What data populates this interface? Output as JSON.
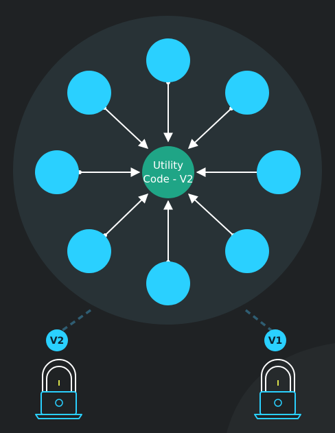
{
  "center": {
    "line1": "Utility",
    "line2": "Code - V2"
  },
  "satellites": [
    {
      "id": "n"
    },
    {
      "id": "ne"
    },
    {
      "id": "e"
    },
    {
      "id": "se"
    },
    {
      "id": "s"
    },
    {
      "id": "sw"
    },
    {
      "id": "w"
    },
    {
      "id": "nw"
    }
  ],
  "users": [
    {
      "id": "left",
      "version": "V2"
    },
    {
      "id": "right",
      "version": "V1"
    }
  ],
  "colors": {
    "background": "#1f2224",
    "cluster": "#283236",
    "satellite": "#2ad0ff",
    "center": "#1fa586",
    "arrow": "#ffffff",
    "dash": "#2f5d72",
    "badge": "#2ad0ff",
    "person_outline": "#ffffff",
    "laptop": "#2ad0ff",
    "accent": "#d9e04a"
  }
}
